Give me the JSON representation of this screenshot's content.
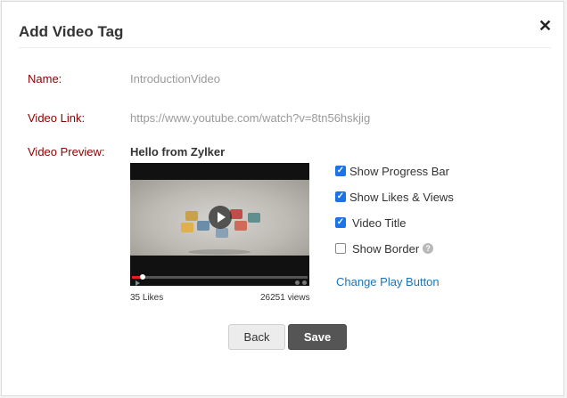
{
  "dialog": {
    "title": "Add Video Tag",
    "close_icon": "close-icon"
  },
  "form": {
    "name_label": "Name:",
    "name_value": "IntroductionVideo",
    "link_label": "Video Link:",
    "link_value": "https://www.youtube.com/watch?v=8tn56hskjig",
    "preview_label": "Video Preview:"
  },
  "preview": {
    "title": "Hello from Zylker",
    "likes": "35 Likes",
    "views": "26251 views",
    "progress_fraction": 0.06
  },
  "options": [
    {
      "label": "Show Progress Bar",
      "checked": true
    },
    {
      "label": "Show Likes & Views",
      "checked": true
    },
    {
      "label": "Video Title",
      "checked": true
    },
    {
      "label": "Show Border",
      "checked": false,
      "help": "?"
    }
  ],
  "change_play_button": "Change Play Button",
  "buttons": {
    "back": "Back",
    "save": "Save"
  },
  "colors": {
    "label_red": "#8b0000",
    "checkbox_blue": "#1a73e8",
    "link_blue": "#1b74b8",
    "save_bg": "#555555"
  }
}
